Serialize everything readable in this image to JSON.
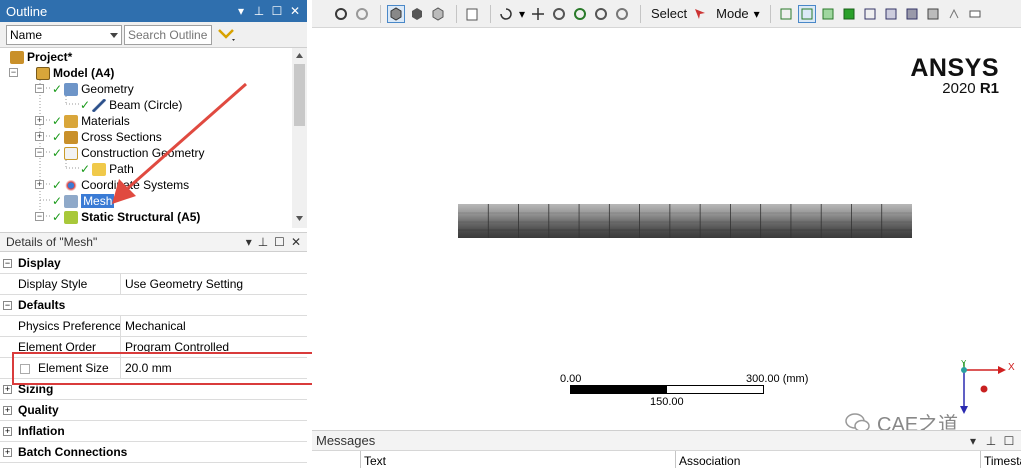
{
  "outline": {
    "title": "Outline",
    "filter_selected": "Name",
    "search_placeholder": "Search Outline",
    "tree": [
      {
        "label": "Project*",
        "level": 0,
        "icon": "project-icon"
      },
      {
        "label": "Model (A4)",
        "level": 1,
        "icon": "model-icon"
      },
      {
        "label": "Geometry",
        "level": 2,
        "icon": "geometry-icon"
      },
      {
        "label": "Beam (Circle)",
        "level": 3,
        "icon": "beam-icon"
      },
      {
        "label": "Materials",
        "level": 2,
        "icon": "materials-icon"
      },
      {
        "label": "Cross Sections",
        "level": 2,
        "icon": "cross-sections-icon"
      },
      {
        "label": "Construction Geometry",
        "level": 2,
        "icon": "construction-geometry-icon"
      },
      {
        "label": "Path",
        "level": 3,
        "icon": "path-icon"
      },
      {
        "label": "Coordinate Systems",
        "level": 2,
        "icon": "coordinate-systems-icon"
      },
      {
        "label": "Mesh",
        "level": 2,
        "icon": "mesh-icon",
        "selected": true
      },
      {
        "label": "Static Structural (A5)",
        "level": 2,
        "icon": "static-structural-icon"
      }
    ]
  },
  "details": {
    "title": "Details of \"Mesh\"",
    "rows": [
      {
        "type": "group",
        "label": "Display",
        "expander": "−"
      },
      {
        "type": "prop",
        "key": "Display Style",
        "value": "Use Geometry Setting"
      },
      {
        "type": "group",
        "label": "Defaults",
        "expander": "−"
      },
      {
        "type": "prop",
        "key": "Physics Preference",
        "value": "Mechanical"
      },
      {
        "type": "prop",
        "key": "Element Order",
        "value": "Program Controlled"
      },
      {
        "type": "prop",
        "key": "Element Size",
        "value": "20.0 mm",
        "checkbox": true
      },
      {
        "type": "group",
        "label": "Sizing",
        "expander": "+"
      },
      {
        "type": "group",
        "label": "Quality",
        "expander": "+"
      },
      {
        "type": "group",
        "label": "Inflation",
        "expander": "+"
      },
      {
        "type": "group",
        "label": "Batch Connections",
        "expander": "+"
      }
    ]
  },
  "toolbar": {
    "select_label": "Select",
    "mode_label": "Mode"
  },
  "viewport": {
    "logo": "ANSYS",
    "version_year": "2020",
    "version_release": "R1",
    "scale_start": "0.00",
    "scale_end": "300.00 (mm)",
    "scale_mid": "150.00",
    "triad_x": "X",
    "triad_y": "Y",
    "watermark": "CAE之道"
  },
  "messages": {
    "title": "Messages",
    "columns": [
      "Text",
      "Association",
      "Timesta"
    ]
  },
  "colors": {
    "title_bar": "#2f6fae",
    "selection": "#3a7bd5",
    "highlight": "#d93b3b",
    "check": "#1a9a1a"
  }
}
